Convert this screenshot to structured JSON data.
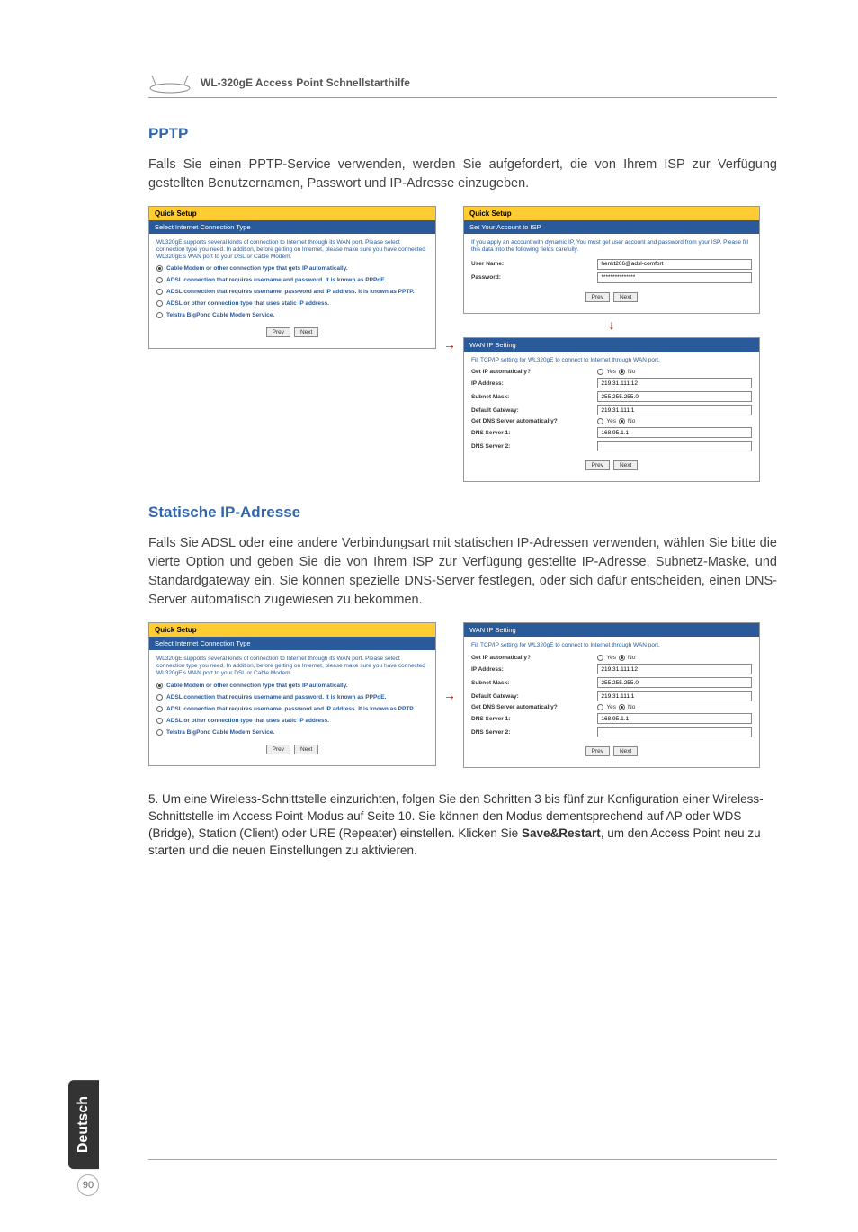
{
  "header": {
    "doc_title": "WL-320gE Access Point Schnellstarthilfe"
  },
  "pptp": {
    "title": "PPTP",
    "body": "Falls Sie einen PPTP-Service verwenden, werden Sie aufgefordert, die von Ihrem ISP zur Verfügung gestellten Benutzernamen, Passwort und IP-Adresse einzugeben."
  },
  "static_ip": {
    "title": "Statische IP-Adresse",
    "body": "Falls Sie ADSL oder eine andere Verbindungsart mit statischen IP-Adressen verwenden, wählen Sie bitte die vierte Option und geben Sie die von Ihrem ISP zur Verfügung gestellte IP-Adresse, Subnetz-Maske, und Standardgateway ein. Sie können spezielle DNS-Server festlegen, oder sich dafür entscheiden, einen DNS-Server automatisch zugewiesen zu bekommen."
  },
  "quick_setup": {
    "header": "Quick Setup",
    "subheader": "Select Internet Connection Type",
    "desc": "WL320gE supports several kinds of connection to Internet through its WAN port. Please select connection type you need. In addition, before getting on Internet, please make sure you have connected WL320gE's WAN port to your DSL or Cable Modem.",
    "opt1": "Cable Modem or other connection type that gets IP automatically.",
    "opt2": "ADSL connection that requires username and password. It is known as PPPoE.",
    "opt3": "ADSL connection that requires username, password and IP address. It is known as PPTP.",
    "opt4": "ADSL or other connection type that uses static IP address.",
    "opt5": "Telstra BigPond Cable Modem Service.",
    "prev": "Prev",
    "next": "Next"
  },
  "isp_account": {
    "header": "Quick Setup",
    "subheader": "Set Your Account to ISP",
    "desc": "If you apply an account with dynamic IP, You must get user account and password from your ISP. Please fill this data into the following fields carefully.",
    "user_label": "User Name:",
    "user_value": "henkt206@adsl-comfort",
    "pass_label": "Password:",
    "pass_value": "***************"
  },
  "wan_ip": {
    "subheader": "WAN IP Setting",
    "desc": "Fill TCP/IP setting for WL320gE to connect to Internet through WAN port.",
    "get_ip": "Get IP automatically?",
    "ip_addr": "IP Address:",
    "ip_addr_v": "219.31.111.12",
    "subnet": "Subnet Mask:",
    "subnet_v": "255.255.255.0",
    "gateway": "Default Gateway:",
    "gateway_v": "219.31.111.1",
    "get_dns": "Get DNS Server automatically?",
    "dns1": "DNS Server 1:",
    "dns1_v": "168.95.1.1",
    "dns2": "DNS Server 2:",
    "yes": "Yes",
    "no": "No"
  },
  "step5": {
    "text": "5. Um eine Wireless-Schnittstelle einzurichten, folgen Sie den Schritten 3 bis fünf zur Konfiguration einer Wireless-Schnittstelle im Access Point-Modus auf Seite 10. Sie können den Modus dementsprechend auf AP oder WDS (Bridge), Station (Client) oder URE (Repeater) einstellen. Klicken Sie ",
    "bold": "Save&Restart",
    "text2": ", um den Access Point neu zu starten und die neuen Einstellungen zu aktivieren."
  },
  "footer": {
    "language": "Deutsch",
    "page": "90"
  }
}
